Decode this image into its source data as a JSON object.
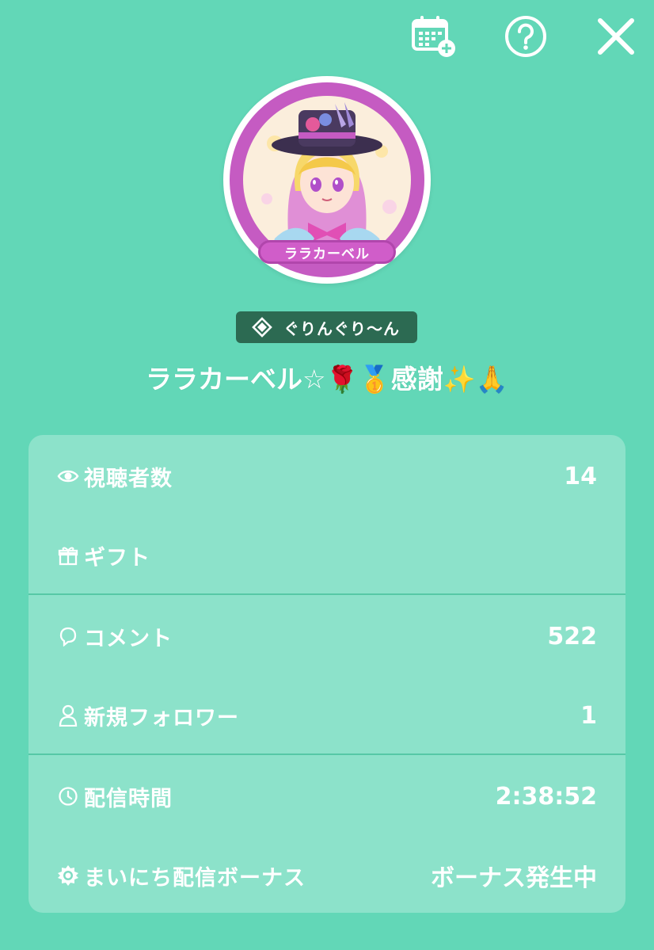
{
  "header": {
    "calendar_icon": "calendar-plus-icon",
    "help_icon": "question-circle-icon",
    "close_icon": "close-icon"
  },
  "avatar": {
    "banner_text": "ララカーベル",
    "ring_color": "#c55bc2"
  },
  "badge": {
    "icon": "diamond-icon",
    "label": "ぐりんぐり〜ん"
  },
  "stream_title": "ララカーベル☆🌹🥇感謝✨🙏",
  "stats": [
    {
      "key": "viewers",
      "icon": "eye-icon",
      "label": "視聴者数",
      "value": "14"
    },
    {
      "key": "gifts",
      "icon": "gift-icon",
      "label": "ギフト",
      "value": ""
    },
    {
      "key": "comments",
      "icon": "comment-icon",
      "label": "コメント",
      "value": "522"
    },
    {
      "key": "followers",
      "icon": "person-icon",
      "label": "新規フォロワー",
      "value": "1"
    },
    {
      "key": "duration",
      "icon": "clock-icon",
      "label": "配信時間",
      "value": "2:38:52"
    },
    {
      "key": "bonus",
      "icon": "sun-badge-icon",
      "label": "まいにち配信ボーナス",
      "value": "ボーナス発生中"
    }
  ],
  "colors": {
    "background": "#62d7b7",
    "badge": "#2c6a52",
    "text": "#ffffff"
  }
}
